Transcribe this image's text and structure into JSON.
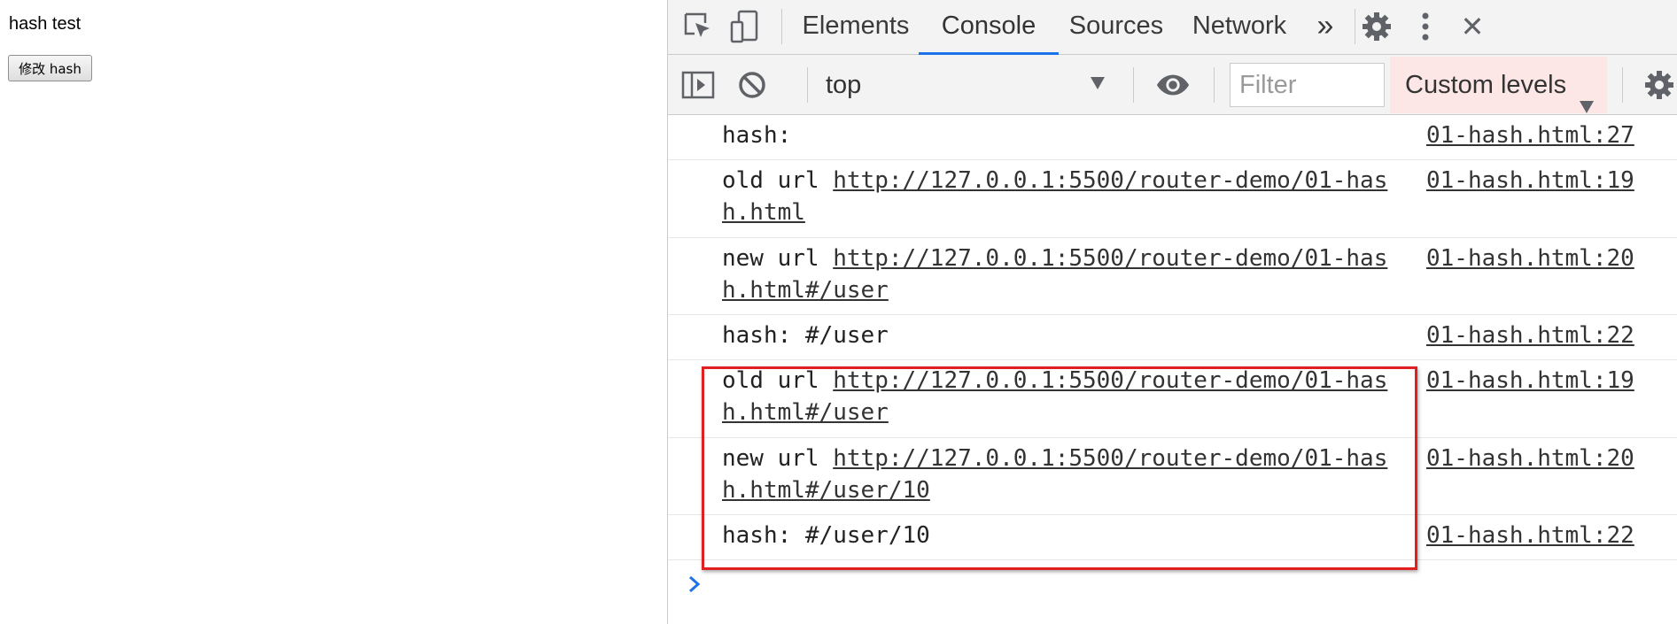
{
  "page": {
    "title": "hash test",
    "button_label": "修改 hash"
  },
  "devtools": {
    "tabs": [
      "Elements",
      "Console",
      "Sources",
      "Network"
    ],
    "active_tab": "Console",
    "more_tabs_glyph": "»",
    "close_glyph": "✕",
    "toolbar": {
      "context": "top",
      "filter_placeholder": "Filter",
      "levels_label": "Custom levels"
    },
    "console_messages": [
      {
        "label": "hash:",
        "url": "",
        "source": "01-hash.html:27"
      },
      {
        "label": "old url ",
        "url": "http://127.0.0.1:5500/router-demo/01-hash.html",
        "source": "01-hash.html:19"
      },
      {
        "label": "new url ",
        "url": "http://127.0.0.1:5500/router-demo/01-hash.html#/user",
        "source": "01-hash.html:20"
      },
      {
        "label": "hash: #/user",
        "url": "",
        "source": "01-hash.html:22"
      },
      {
        "label": "old url ",
        "url": "http://127.0.0.1:5500/router-demo/01-hash.html#/user",
        "source": "01-hash.html:19"
      },
      {
        "label": "new url ",
        "url": "http://127.0.0.1:5500/router-demo/01-hash.html#/user/10",
        "source": "01-hash.html:20"
      },
      {
        "label": "hash: #/user/10",
        "url": "",
        "source": "01-hash.html:22"
      }
    ],
    "colors": {
      "accent": "#1a73e8",
      "highlight_box": "#e02020",
      "levels_background": "#fde6e6"
    },
    "icons": [
      "inspect-icon",
      "device-toggle-icon",
      "gear-icon",
      "kebab-menu-icon",
      "close-icon",
      "sidebar-toggle-icon",
      "clear-console-icon",
      "eye-icon",
      "prompt-chevron-icon"
    ]
  }
}
